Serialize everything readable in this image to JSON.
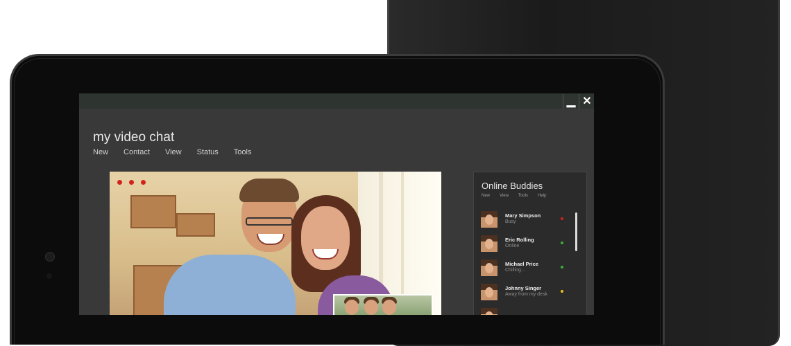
{
  "window": {
    "minimize_glyph": "▁",
    "close_glyph": "✕"
  },
  "app": {
    "title": "my video chat",
    "menu": [
      "New",
      "Contact",
      "View",
      "Status",
      "Tools"
    ]
  },
  "buddies": {
    "title": "Online Buddies",
    "menu": [
      "New",
      "View",
      "Tools",
      "Help"
    ],
    "items": [
      {
        "name": "Mary Simpson",
        "status": "Busy",
        "indicator_color": "#d3221c"
      },
      {
        "name": "Eric Rolling",
        "status": "Online",
        "indicator_color": "#3fae3f"
      },
      {
        "name": "Michael Price",
        "status": "Chilling...",
        "indicator_color": "#3fae3f"
      },
      {
        "name": "Johnny Singer",
        "status": "Away from my desk",
        "indicator_color": "#e8c21c"
      }
    ]
  },
  "colors": {
    "record_dots": "#d3221c",
    "window_bg": "#393939",
    "titlebar": "#2e3430"
  },
  "icons": {
    "minimize": "minimize-icon",
    "close": "close-icon",
    "recording": "recording-dots-icon",
    "camera": "front-camera-icon"
  }
}
